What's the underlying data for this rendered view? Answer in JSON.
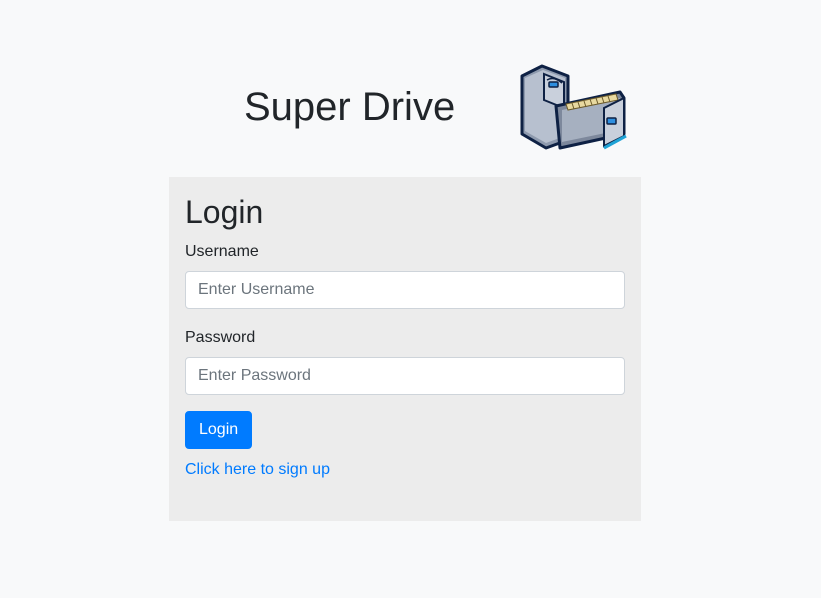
{
  "header": {
    "title": "Super Drive",
    "logo_icon": "file-cabinet-icon"
  },
  "login": {
    "heading": "Login",
    "username": {
      "label": "Username",
      "placeholder": "Enter Username",
      "value": ""
    },
    "password": {
      "label": "Password",
      "placeholder": "Enter Password",
      "value": ""
    },
    "submit_label": "Login",
    "signup_link": "Click here to sign up"
  },
  "colors": {
    "page_background": "#f8f9fa",
    "card_background": "#ececec",
    "accent": "#007bff",
    "text": "#212529"
  }
}
